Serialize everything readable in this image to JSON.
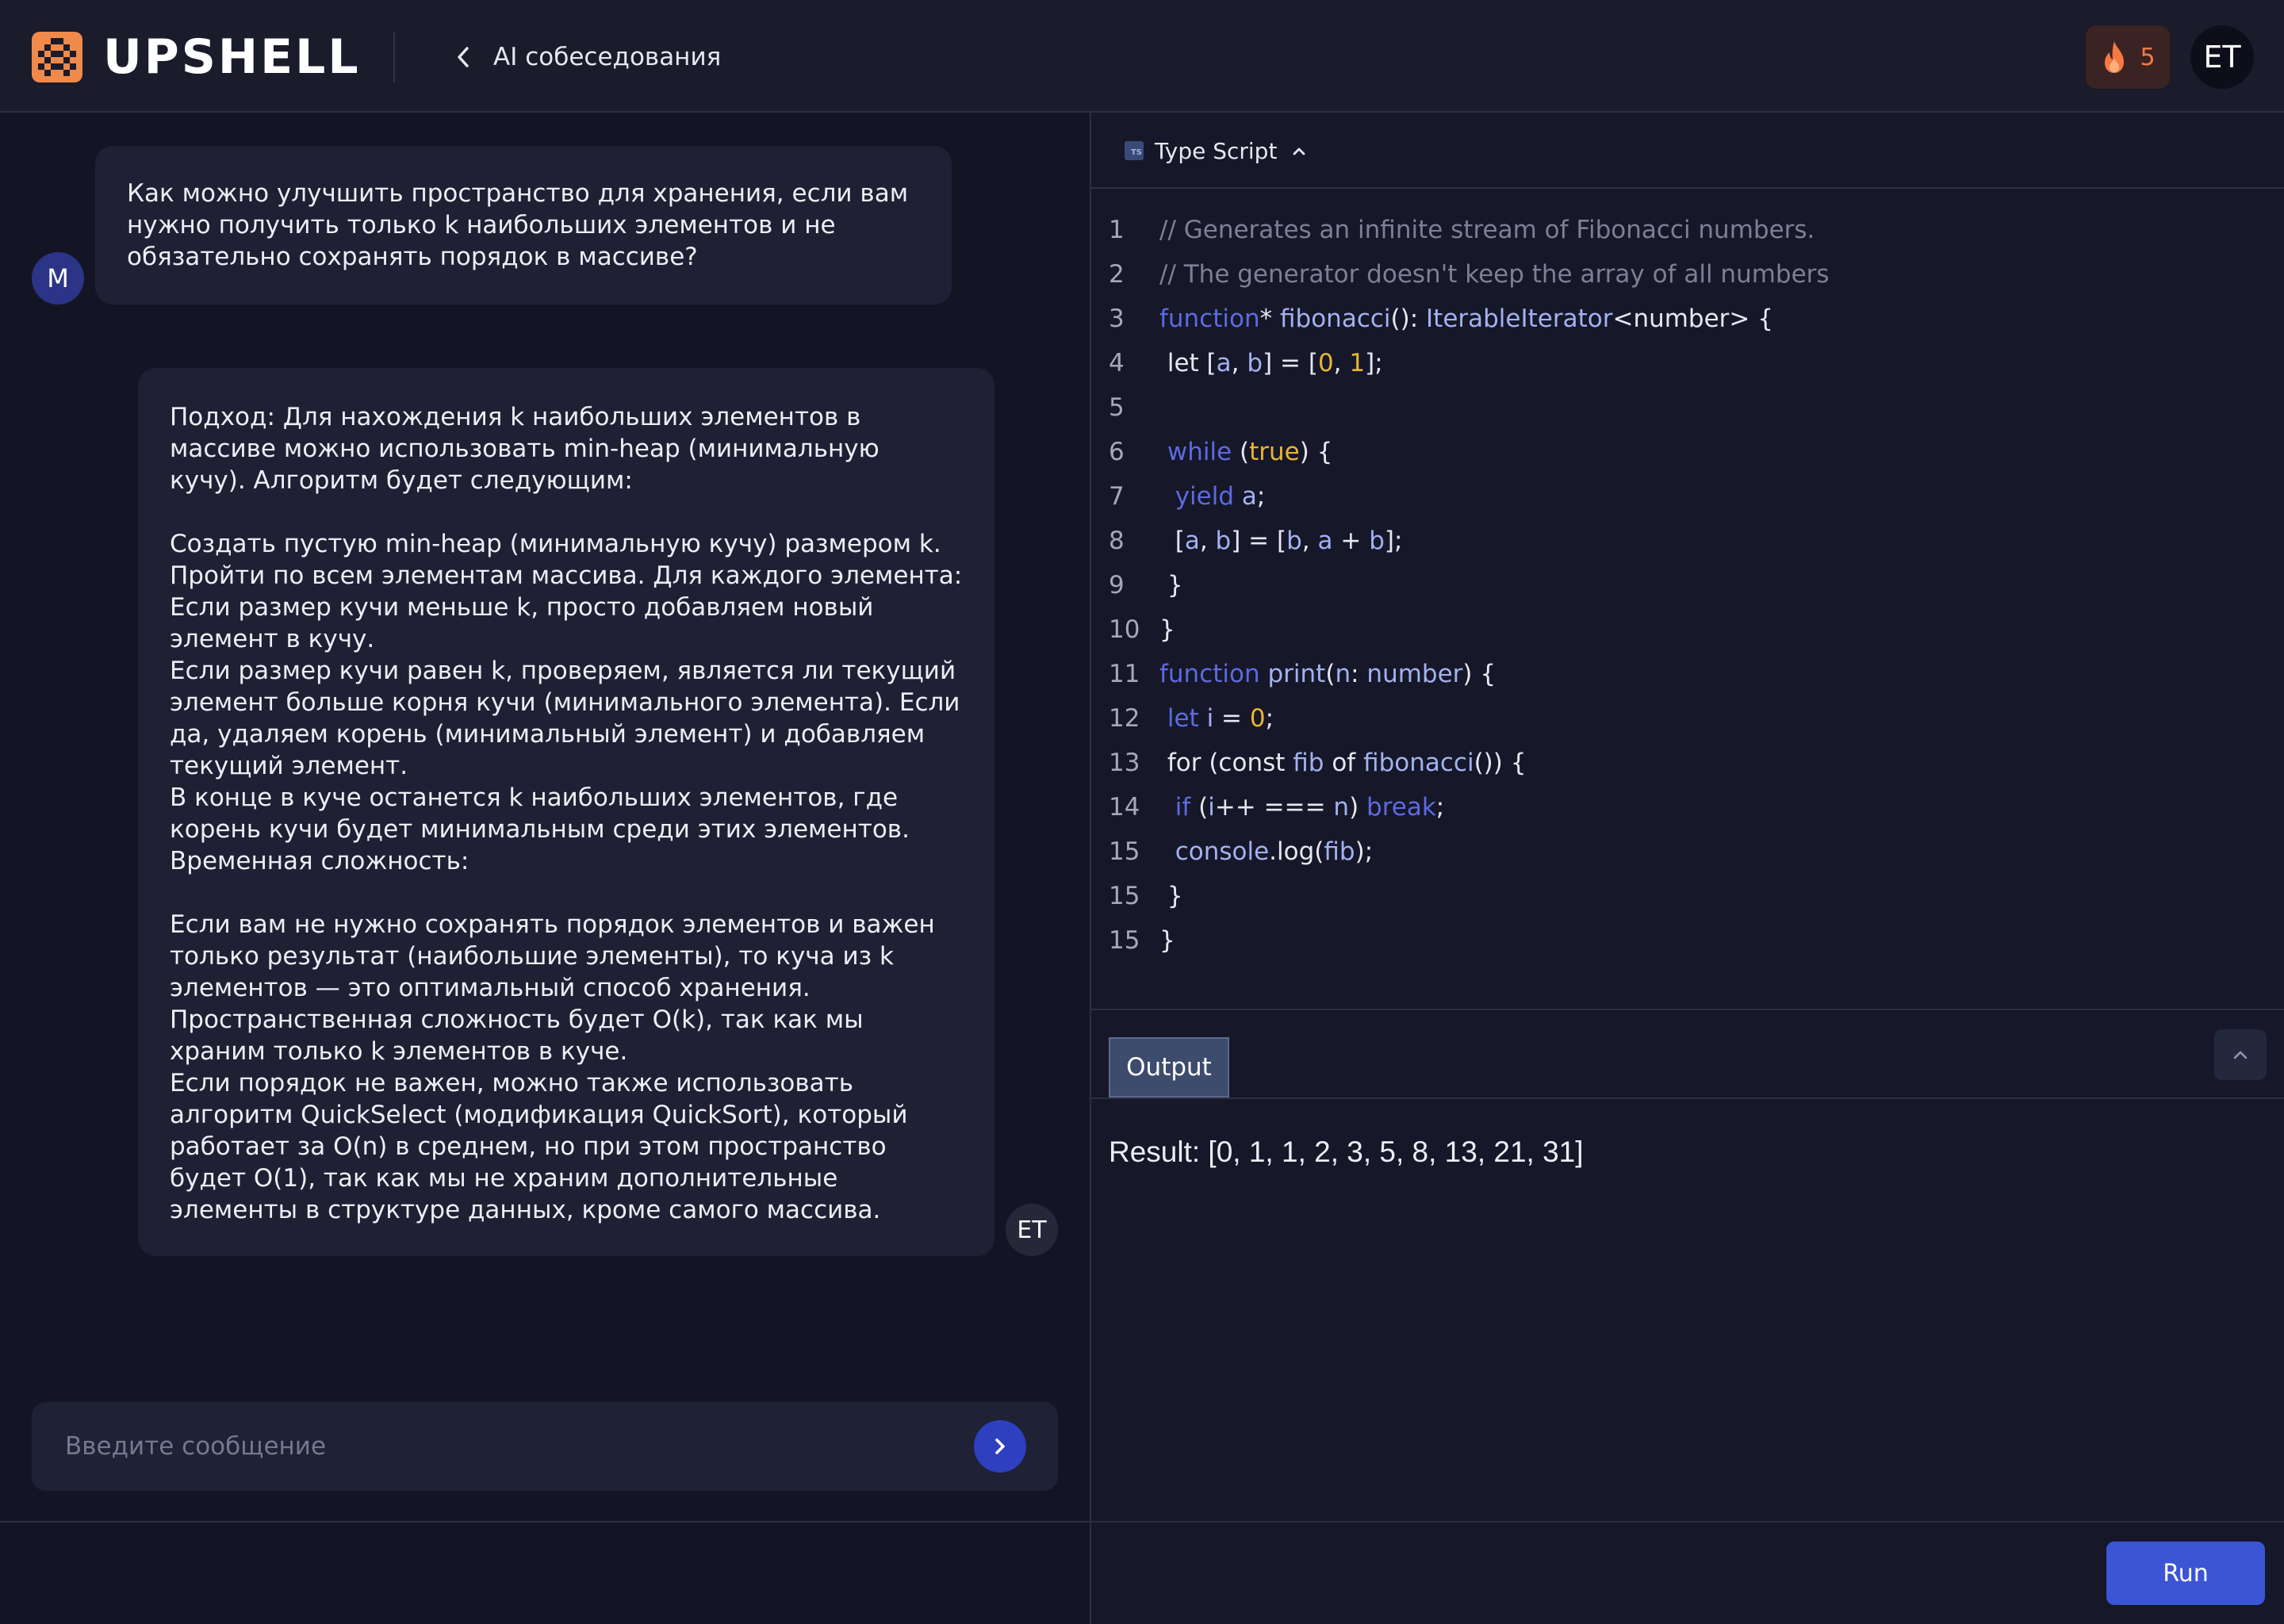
{
  "header": {
    "logo_text": "UPSHELL",
    "back_label": "AI собеседования",
    "streak_count": "5",
    "user_initials": "ET"
  },
  "chat": {
    "user_message": {
      "avatar": "M",
      "text": "Как можно улучшить пространство для хранения, если вам нужно получить только k наибольших элементов и не обязательно сохранять порядок в массиве?"
    },
    "ai_message": {
      "avatar": "ET",
      "text": "Подход: Для нахождения k наибольших элементов в массиве можно использовать min-heap (минимальную кучу). Алгоритм будет следующим:\n\nСоздать пустую min-heap (минимальную кучу) размером k.\nПройти по всем элементам массива. Для каждого элемента:\nЕсли размер кучи меньше k, просто добавляем новый элемент в кучу.\nЕсли размер кучи равен k, проверяем, является ли текущий элемент больше корня кучи (минимального элемента). Если да, удаляем корень (минимальный элемент) и добавляем текущий элемент.\nВ конце в куче останется k наибольших элементов, где корень кучи будет минимальным среди этих элементов.\nВременная сложность:\n\nЕсли вам не нужно сохранять порядок элементов и важен только результат (наибольшие элементы), то куча из k элементов — это оптимальный способ хранения.\nПространственная сложность будет O(k), так как мы храним только k элементов в куче.\nЕсли порядок не важен, можно также использовать алгоритм QuickSelect (модификация QuickSort), который работает за O(n) в среднем, но при этом пространство будет O(1), так как мы не храним дополнительные элементы в структуре данных, кроме самого массива."
    },
    "input_placeholder": "Введите сообщение"
  },
  "editor": {
    "language": "Type Script",
    "language_icon": "TS",
    "lines": [
      {
        "n": "1",
        "tokens": [
          {
            "t": "// Generates an infinite stream of Fibonacci numbers.",
            "c": "comment"
          }
        ]
      },
      {
        "n": "2",
        "tokens": [
          {
            "t": "// The generator doesn't keep the array of all numbers",
            "c": "comment"
          }
        ]
      },
      {
        "n": "3",
        "tokens": [
          {
            "t": "function",
            "c": "kw"
          },
          {
            "t": "* ",
            "c": ""
          },
          {
            "t": "fibonacci",
            "c": "fn"
          },
          {
            "t": "(): ",
            "c": ""
          },
          {
            "t": "IterableIterator",
            "c": "fn"
          },
          {
            "t": "<number> {",
            "c": ""
          }
        ]
      },
      {
        "n": "4",
        "tokens": [
          {
            "t": " let [",
            "c": ""
          },
          {
            "t": "a",
            "c": "var"
          },
          {
            "t": ", ",
            "c": ""
          },
          {
            "t": "b",
            "c": "var"
          },
          {
            "t": "] = [",
            "c": ""
          },
          {
            "t": "0",
            "c": "num"
          },
          {
            "t": ", ",
            "c": ""
          },
          {
            "t": "1",
            "c": "num"
          },
          {
            "t": "];",
            "c": ""
          }
        ]
      },
      {
        "n": "5",
        "tokens": []
      },
      {
        "n": "6",
        "tokens": [
          {
            "t": " while",
            "c": "kw"
          },
          {
            "t": " (",
            "c": ""
          },
          {
            "t": "true",
            "c": "num"
          },
          {
            "t": ") {",
            "c": ""
          }
        ]
      },
      {
        "n": "7",
        "tokens": [
          {
            "t": "  yield",
            "c": "kw"
          },
          {
            "t": " ",
            "c": ""
          },
          {
            "t": "a",
            "c": "var"
          },
          {
            "t": ";",
            "c": ""
          }
        ]
      },
      {
        "n": "8",
        "tokens": [
          {
            "t": "  [",
            "c": ""
          },
          {
            "t": "a",
            "c": "var"
          },
          {
            "t": ", ",
            "c": ""
          },
          {
            "t": "b",
            "c": "var"
          },
          {
            "t": "] = [",
            "c": ""
          },
          {
            "t": "b",
            "c": "var"
          },
          {
            "t": ", ",
            "c": ""
          },
          {
            "t": "a",
            "c": "var"
          },
          {
            "t": " + ",
            "c": ""
          },
          {
            "t": "b",
            "c": "var"
          },
          {
            "t": "];",
            "c": ""
          }
        ]
      },
      {
        "n": "9",
        "tokens": [
          {
            "t": " }",
            "c": ""
          }
        ]
      },
      {
        "n": "10",
        "tokens": [
          {
            "t": "}",
            "c": ""
          }
        ]
      },
      {
        "n": "11",
        "tokens": [
          {
            "t": "function",
            "c": "kw"
          },
          {
            "t": " ",
            "c": ""
          },
          {
            "t": "print",
            "c": "fn"
          },
          {
            "t": "(",
            "c": ""
          },
          {
            "t": "n",
            "c": "var"
          },
          {
            "t": ": ",
            "c": ""
          },
          {
            "t": "number",
            "c": "fn"
          },
          {
            "t": ") {",
            "c": ""
          }
        ]
      },
      {
        "n": "12",
        "tokens": [
          {
            "t": " let",
            "c": "kw"
          },
          {
            "t": " ",
            "c": ""
          },
          {
            "t": "i",
            "c": "var"
          },
          {
            "t": " = ",
            "c": ""
          },
          {
            "t": "0",
            "c": "num"
          },
          {
            "t": ";",
            "c": ""
          }
        ]
      },
      {
        "n": "13",
        "tokens": [
          {
            "t": " for (const ",
            "c": ""
          },
          {
            "t": "fib",
            "c": "var"
          },
          {
            "t": " of ",
            "c": ""
          },
          {
            "t": "fibonacci",
            "c": "fn"
          },
          {
            "t": "()) {",
            "c": ""
          }
        ]
      },
      {
        "n": "14",
        "tokens": [
          {
            "t": "  if",
            "c": "kw"
          },
          {
            "t": " (",
            "c": ""
          },
          {
            "t": "i",
            "c": "var"
          },
          {
            "t": "++ === ",
            "c": ""
          },
          {
            "t": "n",
            "c": "var"
          },
          {
            "t": ") ",
            "c": ""
          },
          {
            "t": "break",
            "c": "kw"
          },
          {
            "t": ";",
            "c": ""
          }
        ]
      },
      {
        "n": "15",
        "tokens": [
          {
            "t": "  console",
            "c": "fn"
          },
          {
            "t": ".log(",
            "c": ""
          },
          {
            "t": "fib",
            "c": "var"
          },
          {
            "t": ");",
            "c": ""
          }
        ]
      },
      {
        "n": "15",
        "tokens": [
          {
            "t": " }",
            "c": ""
          }
        ]
      },
      {
        "n": "15",
        "tokens": [
          {
            "t": "}",
            "c": ""
          }
        ]
      }
    ]
  },
  "output": {
    "tab_label": "Output",
    "result": "Result: [0, 1, 1, 2, 3, 5, 8, 13, 21, 31]"
  },
  "run_label": "Run",
  "colors": {
    "accent": "#3b55d6",
    "brand": "#f08a4b",
    "streak": "#f47a44",
    "keyword": "#5c6be0",
    "number": "#e8b533"
  }
}
